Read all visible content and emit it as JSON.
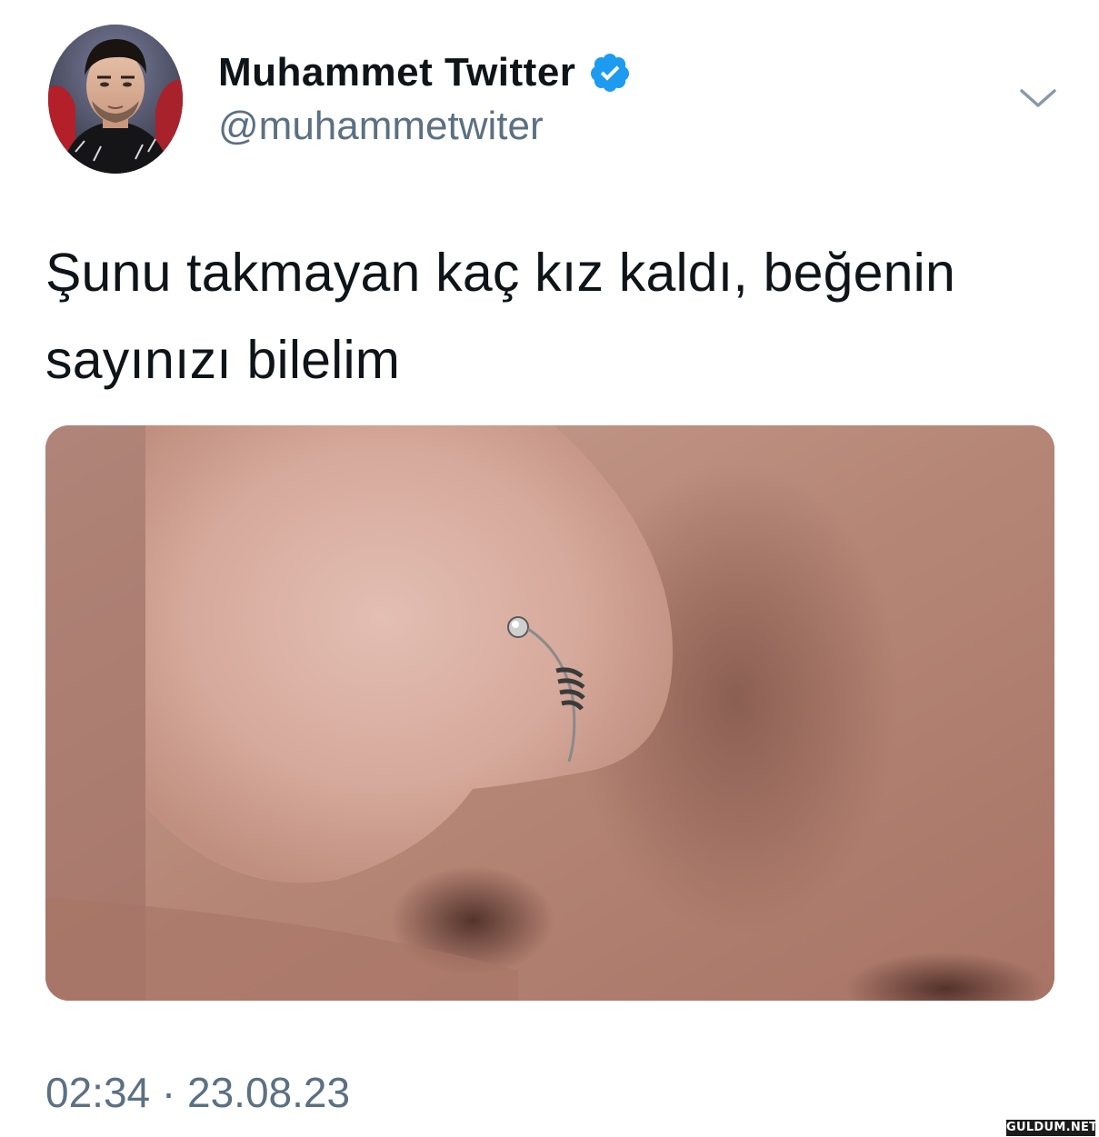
{
  "author": {
    "name": "Muhammet Twitter",
    "handle": "@muhammetwiter",
    "verified": true,
    "avatar_icon": "profile-photo"
  },
  "tweet": {
    "text_line1": "Şunu takmayan kaç kız kaldı, beğenin",
    "text_line2": "sayınızı bilelim",
    "media_icon": "photo-nose-piercing"
  },
  "meta": {
    "time": "02:34",
    "separator": "·",
    "date": "23.08.23"
  },
  "watermark": {
    "text": "GULDUM.NET"
  },
  "colors": {
    "verified_blue": "#1d9bf0",
    "secondary_text": "#5b7083",
    "primary_text": "#0f1419",
    "chevron": "#8899a6"
  }
}
